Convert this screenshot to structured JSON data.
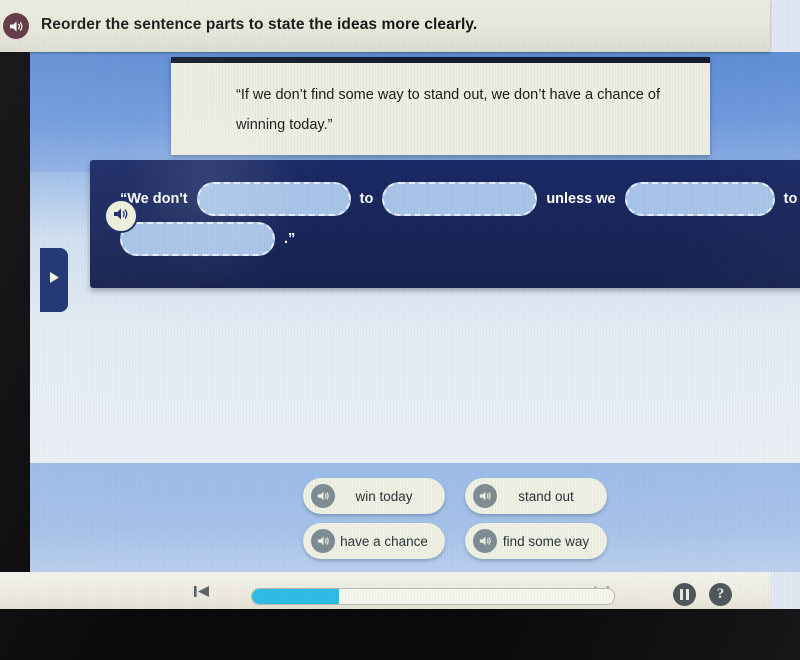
{
  "header": {
    "instruction": "Reorder the sentence parts to state the ideas more clearly.",
    "speaker_icon": "speaker-icon"
  },
  "side_tab": {
    "icon": "play-triangle-icon"
  },
  "prompt": {
    "quote": "“If we don’t find some way to stand out, we don’t have a chance of winning today.”"
  },
  "sentence_builder": {
    "speaker_icon": "speaker-icon",
    "parts": [
      {
        "type": "text",
        "value": "“We don't"
      },
      {
        "type": "slot",
        "value": "",
        "index": 1
      },
      {
        "type": "text",
        "value": "to"
      },
      {
        "type": "slot",
        "value": "",
        "index": 2
      },
      {
        "type": "text",
        "value": "unless we"
      },
      {
        "type": "slot",
        "value": "",
        "index": 3
      },
      {
        "type": "text",
        "value": "to"
      },
      {
        "type": "slot",
        "value": "",
        "index": 4
      },
      {
        "type": "text",
        "value": ".”"
      }
    ]
  },
  "word_bank": {
    "tiles": [
      {
        "label": "win today",
        "speaker_icon": "speaker-icon"
      },
      {
        "label": "stand out",
        "speaker_icon": "speaker-icon"
      },
      {
        "label": "have a chance",
        "speaker_icon": "speaker-icon"
      },
      {
        "label": "find some way",
        "speaker_icon": "speaker-icon"
      }
    ]
  },
  "toolbar": {
    "prev_icon": "skip-previous-icon",
    "next_icon": "skip-next-icon",
    "pause_icon": "pause-icon",
    "help_icon": "help-question-icon",
    "progress_percent": 24
  },
  "colors": {
    "accent_progress": "#2fbce4",
    "panel_navy": "#1b2a66",
    "slot_fill": "#a8c4e8",
    "header_bg": "#e8e7db",
    "tile_bg": "#eef0e4"
  }
}
